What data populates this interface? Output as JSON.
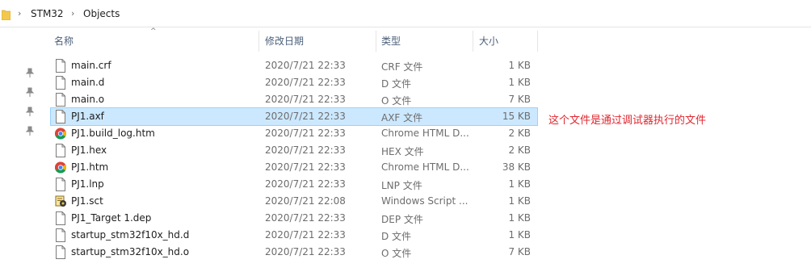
{
  "breadcrumb": {
    "items": [
      "STM32",
      "Objects"
    ]
  },
  "columns": {
    "name": "名称",
    "date": "修改日期",
    "type": "类型",
    "size": "大小"
  },
  "files": [
    {
      "name": "main.crf",
      "date": "2020/7/21 22:33",
      "type": "CRF 文件",
      "size": "1 KB",
      "icon": "file-icon",
      "selected": false
    },
    {
      "name": "main.d",
      "date": "2020/7/21 22:33",
      "type": "D 文件",
      "size": "1 KB",
      "icon": "file-icon",
      "selected": false
    },
    {
      "name": "main.o",
      "date": "2020/7/21 22:33",
      "type": "O 文件",
      "size": "7 KB",
      "icon": "file-icon",
      "selected": false
    },
    {
      "name": "PJ1.axf",
      "date": "2020/7/21 22:33",
      "type": "AXF 文件",
      "size": "15 KB",
      "icon": "file-icon",
      "selected": true
    },
    {
      "name": "PJ1.build_log.htm",
      "date": "2020/7/21 22:33",
      "type": "Chrome HTML D...",
      "size": "2 KB",
      "icon": "chrome-icon",
      "selected": false
    },
    {
      "name": "PJ1.hex",
      "date": "2020/7/21 22:33",
      "type": "HEX 文件",
      "size": "2 KB",
      "icon": "file-icon",
      "selected": false
    },
    {
      "name": "PJ1.htm",
      "date": "2020/7/21 22:33",
      "type": "Chrome HTML D...",
      "size": "38 KB",
      "icon": "chrome-icon",
      "selected": false
    },
    {
      "name": "PJ1.lnp",
      "date": "2020/7/21 22:33",
      "type": "LNP 文件",
      "size": "1 KB",
      "icon": "file-icon",
      "selected": false
    },
    {
      "name": "PJ1.sct",
      "date": "2020/7/21 22:08",
      "type": "Windows Script ...",
      "size": "1 KB",
      "icon": "script-icon",
      "selected": false
    },
    {
      "name": "PJ1_Target 1.dep",
      "date": "2020/7/21 22:33",
      "type": "DEP 文件",
      "size": "1 KB",
      "icon": "file-icon",
      "selected": false
    },
    {
      "name": "startup_stm32f10x_hd.d",
      "date": "2020/7/21 22:33",
      "type": "D 文件",
      "size": "1 KB",
      "icon": "file-icon",
      "selected": false
    },
    {
      "name": "startup_stm32f10x_hd.o",
      "date": "2020/7/21 22:33",
      "type": "O 文件",
      "size": "7 KB",
      "icon": "file-icon",
      "selected": false
    }
  ],
  "annotation": "这个文件是通过调试器执行的文件",
  "colors": {
    "selection": "#cce8ff",
    "annotation": "#e0262f",
    "header": "#4c607a"
  }
}
